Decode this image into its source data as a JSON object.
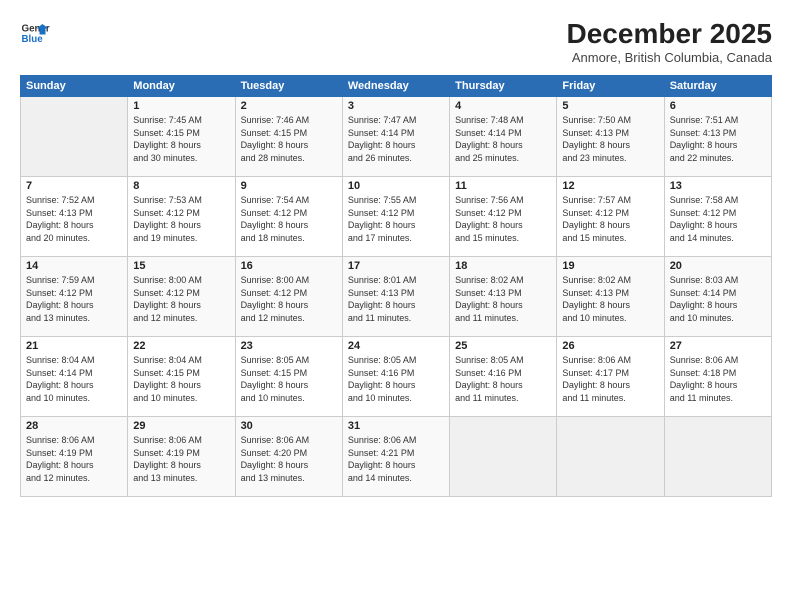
{
  "header": {
    "logo_line1": "General",
    "logo_line2": "Blue",
    "title": "December 2025",
    "location": "Anmore, British Columbia, Canada"
  },
  "days_of_week": [
    "Sunday",
    "Monday",
    "Tuesday",
    "Wednesday",
    "Thursday",
    "Friday",
    "Saturday"
  ],
  "weeks": [
    [
      {
        "day": "",
        "info": ""
      },
      {
        "day": "1",
        "info": "Sunrise: 7:45 AM\nSunset: 4:15 PM\nDaylight: 8 hours\nand 30 minutes."
      },
      {
        "day": "2",
        "info": "Sunrise: 7:46 AM\nSunset: 4:15 PM\nDaylight: 8 hours\nand 28 minutes."
      },
      {
        "day": "3",
        "info": "Sunrise: 7:47 AM\nSunset: 4:14 PM\nDaylight: 8 hours\nand 26 minutes."
      },
      {
        "day": "4",
        "info": "Sunrise: 7:48 AM\nSunset: 4:14 PM\nDaylight: 8 hours\nand 25 minutes."
      },
      {
        "day": "5",
        "info": "Sunrise: 7:50 AM\nSunset: 4:13 PM\nDaylight: 8 hours\nand 23 minutes."
      },
      {
        "day": "6",
        "info": "Sunrise: 7:51 AM\nSunset: 4:13 PM\nDaylight: 8 hours\nand 22 minutes."
      }
    ],
    [
      {
        "day": "7",
        "info": "Sunrise: 7:52 AM\nSunset: 4:13 PM\nDaylight: 8 hours\nand 20 minutes."
      },
      {
        "day": "8",
        "info": "Sunrise: 7:53 AM\nSunset: 4:12 PM\nDaylight: 8 hours\nand 19 minutes."
      },
      {
        "day": "9",
        "info": "Sunrise: 7:54 AM\nSunset: 4:12 PM\nDaylight: 8 hours\nand 18 minutes."
      },
      {
        "day": "10",
        "info": "Sunrise: 7:55 AM\nSunset: 4:12 PM\nDaylight: 8 hours\nand 17 minutes."
      },
      {
        "day": "11",
        "info": "Sunrise: 7:56 AM\nSunset: 4:12 PM\nDaylight: 8 hours\nand 15 minutes."
      },
      {
        "day": "12",
        "info": "Sunrise: 7:57 AM\nSunset: 4:12 PM\nDaylight: 8 hours\nand 15 minutes."
      },
      {
        "day": "13",
        "info": "Sunrise: 7:58 AM\nSunset: 4:12 PM\nDaylight: 8 hours\nand 14 minutes."
      }
    ],
    [
      {
        "day": "14",
        "info": "Sunrise: 7:59 AM\nSunset: 4:12 PM\nDaylight: 8 hours\nand 13 minutes."
      },
      {
        "day": "15",
        "info": "Sunrise: 8:00 AM\nSunset: 4:12 PM\nDaylight: 8 hours\nand 12 minutes."
      },
      {
        "day": "16",
        "info": "Sunrise: 8:00 AM\nSunset: 4:12 PM\nDaylight: 8 hours\nand 12 minutes."
      },
      {
        "day": "17",
        "info": "Sunrise: 8:01 AM\nSunset: 4:13 PM\nDaylight: 8 hours\nand 11 minutes."
      },
      {
        "day": "18",
        "info": "Sunrise: 8:02 AM\nSunset: 4:13 PM\nDaylight: 8 hours\nand 11 minutes."
      },
      {
        "day": "19",
        "info": "Sunrise: 8:02 AM\nSunset: 4:13 PM\nDaylight: 8 hours\nand 10 minutes."
      },
      {
        "day": "20",
        "info": "Sunrise: 8:03 AM\nSunset: 4:14 PM\nDaylight: 8 hours\nand 10 minutes."
      }
    ],
    [
      {
        "day": "21",
        "info": "Sunrise: 8:04 AM\nSunset: 4:14 PM\nDaylight: 8 hours\nand 10 minutes."
      },
      {
        "day": "22",
        "info": "Sunrise: 8:04 AM\nSunset: 4:15 PM\nDaylight: 8 hours\nand 10 minutes."
      },
      {
        "day": "23",
        "info": "Sunrise: 8:05 AM\nSunset: 4:15 PM\nDaylight: 8 hours\nand 10 minutes."
      },
      {
        "day": "24",
        "info": "Sunrise: 8:05 AM\nSunset: 4:16 PM\nDaylight: 8 hours\nand 10 minutes."
      },
      {
        "day": "25",
        "info": "Sunrise: 8:05 AM\nSunset: 4:16 PM\nDaylight: 8 hours\nand 11 minutes."
      },
      {
        "day": "26",
        "info": "Sunrise: 8:06 AM\nSunset: 4:17 PM\nDaylight: 8 hours\nand 11 minutes."
      },
      {
        "day": "27",
        "info": "Sunrise: 8:06 AM\nSunset: 4:18 PM\nDaylight: 8 hours\nand 11 minutes."
      }
    ],
    [
      {
        "day": "28",
        "info": "Sunrise: 8:06 AM\nSunset: 4:19 PM\nDaylight: 8 hours\nand 12 minutes."
      },
      {
        "day": "29",
        "info": "Sunrise: 8:06 AM\nSunset: 4:19 PM\nDaylight: 8 hours\nand 13 minutes."
      },
      {
        "day": "30",
        "info": "Sunrise: 8:06 AM\nSunset: 4:20 PM\nDaylight: 8 hours\nand 13 minutes."
      },
      {
        "day": "31",
        "info": "Sunrise: 8:06 AM\nSunset: 4:21 PM\nDaylight: 8 hours\nand 14 minutes."
      },
      {
        "day": "",
        "info": ""
      },
      {
        "day": "",
        "info": ""
      },
      {
        "day": "",
        "info": ""
      }
    ]
  ]
}
